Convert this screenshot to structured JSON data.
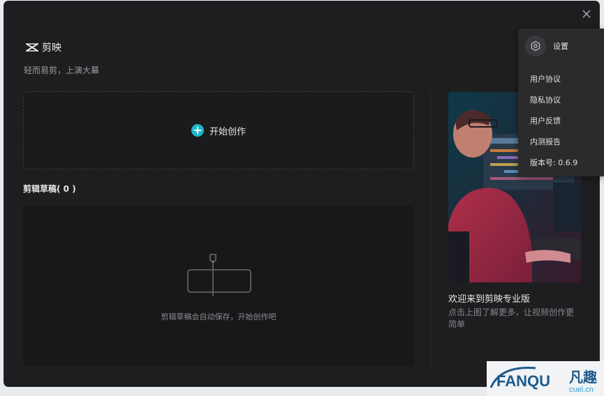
{
  "app": {
    "name": "剪映",
    "tagline": "轻而易剪，上演大幕"
  },
  "create": {
    "label": "开始创作"
  },
  "drafts": {
    "title": "剪辑草稿( 0 )",
    "empty_hint": "剪辑草稿会自动保存，开始创作吧"
  },
  "promo": {
    "title": "欢迎来到剪映专业版",
    "description": "点击上图了解更多，让视频创作更简单"
  },
  "settings_menu": {
    "label": "设置",
    "items": [
      "用户协议",
      "隐私协议",
      "用户反馈",
      "内测报告",
      "版本号: 0.6.9"
    ]
  },
  "watermark": {
    "brand": "FANQU",
    "cn": "凡趣",
    "domain": "cuel.cn"
  },
  "colors": {
    "window_bg": "#1e1e20",
    "accent": "#1fb6c9",
    "menu_bg": "#2b2b2e"
  }
}
